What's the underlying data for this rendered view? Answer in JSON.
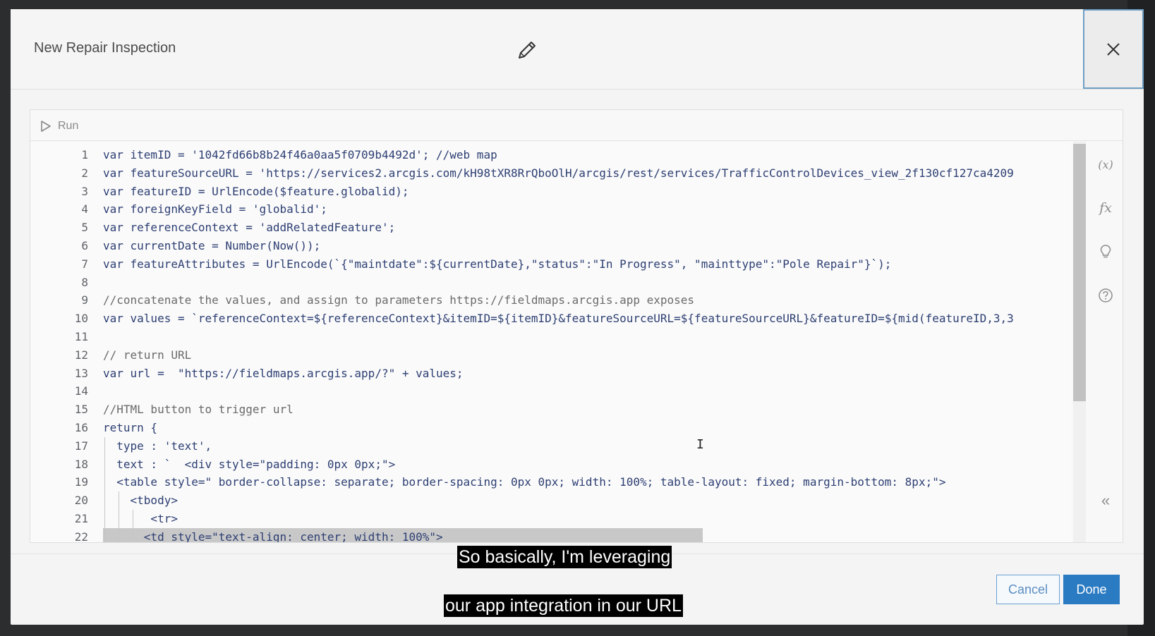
{
  "dialog": {
    "title": "New Repair Inspection",
    "edit_icon": "pencil-icon",
    "close_icon": "close-icon"
  },
  "toolbar": {
    "run_label": "Run",
    "run_icon": "play-icon"
  },
  "editor": {
    "lines": [
      {
        "n": "1",
        "text": "var itemID = '1042fd66b8b24f46a0aa5f0709b4492d'; //web map"
      },
      {
        "n": "2",
        "text": "var featureSourceURL = 'https://services2.arcgis.com/kH98tXR8RrQboOlH/arcgis/rest/services/TrafficControlDevices_view_2f130cf127ca4209"
      },
      {
        "n": "3",
        "text": "var featureID = UrlEncode($feature.globalid);"
      },
      {
        "n": "4",
        "text": "var foreignKeyField = 'globalid';"
      },
      {
        "n": "5",
        "text": "var referenceContext = 'addRelatedFeature';"
      },
      {
        "n": "6",
        "text": "var currentDate = Number(Now());"
      },
      {
        "n": "7",
        "text": "var featureAttributes = UrlEncode(`{\"maintdate\":${currentDate},\"status\":\"In Progress\", \"mainttype\":\"Pole Repair\"}`);"
      },
      {
        "n": "8",
        "text": ""
      },
      {
        "n": "9",
        "text": "//concatenate the values, and assign to parameters https://fieldmaps.arcgis.app exposes"
      },
      {
        "n": "10",
        "text": "var values = `referenceContext=${referenceContext}&itemID=${itemID}&featureSourceURL=${featureSourceURL}&featureID=${mid(featureID,3,3"
      },
      {
        "n": "11",
        "text": ""
      },
      {
        "n": "12",
        "text": "// return URL"
      },
      {
        "n": "13",
        "text": "var url =  \"https://fieldmaps.arcgis.app/?\" + values;"
      },
      {
        "n": "14",
        "text": ""
      },
      {
        "n": "15",
        "text": "//HTML button to trigger url"
      },
      {
        "n": "16",
        "text": "return {"
      },
      {
        "n": "17",
        "text": "  type : 'text',"
      },
      {
        "n": "18",
        "text": "  text : `  <div style=\"padding: 0px 0px;\">"
      },
      {
        "n": "19",
        "text": "  <table style=\" border-collapse: separate; border-spacing: 0px 0px; width: 100%; table-layout: fixed; margin-bottom: 8px;\">"
      },
      {
        "n": "20",
        "text": "    <tbody>"
      },
      {
        "n": "21",
        "text": "       <tr>"
      },
      {
        "n": "22",
        "text": "      <td style=\"text-align: center; width: 100%\">"
      }
    ]
  },
  "side_tools": [
    {
      "name": "variables-tool",
      "label": "(x)"
    },
    {
      "name": "functions-tool",
      "label": "fx"
    },
    {
      "name": "lightbulb-icon",
      "label": ""
    },
    {
      "name": "help-icon",
      "label": ""
    },
    {
      "name": "collapse-panel-icon",
      "label": "«"
    }
  ],
  "captions": {
    "line1": "So basically, I'm leveraging",
    "line2": "our app integration in our URL"
  },
  "footer": {
    "cancel_label": "Cancel",
    "done_label": "Done"
  }
}
